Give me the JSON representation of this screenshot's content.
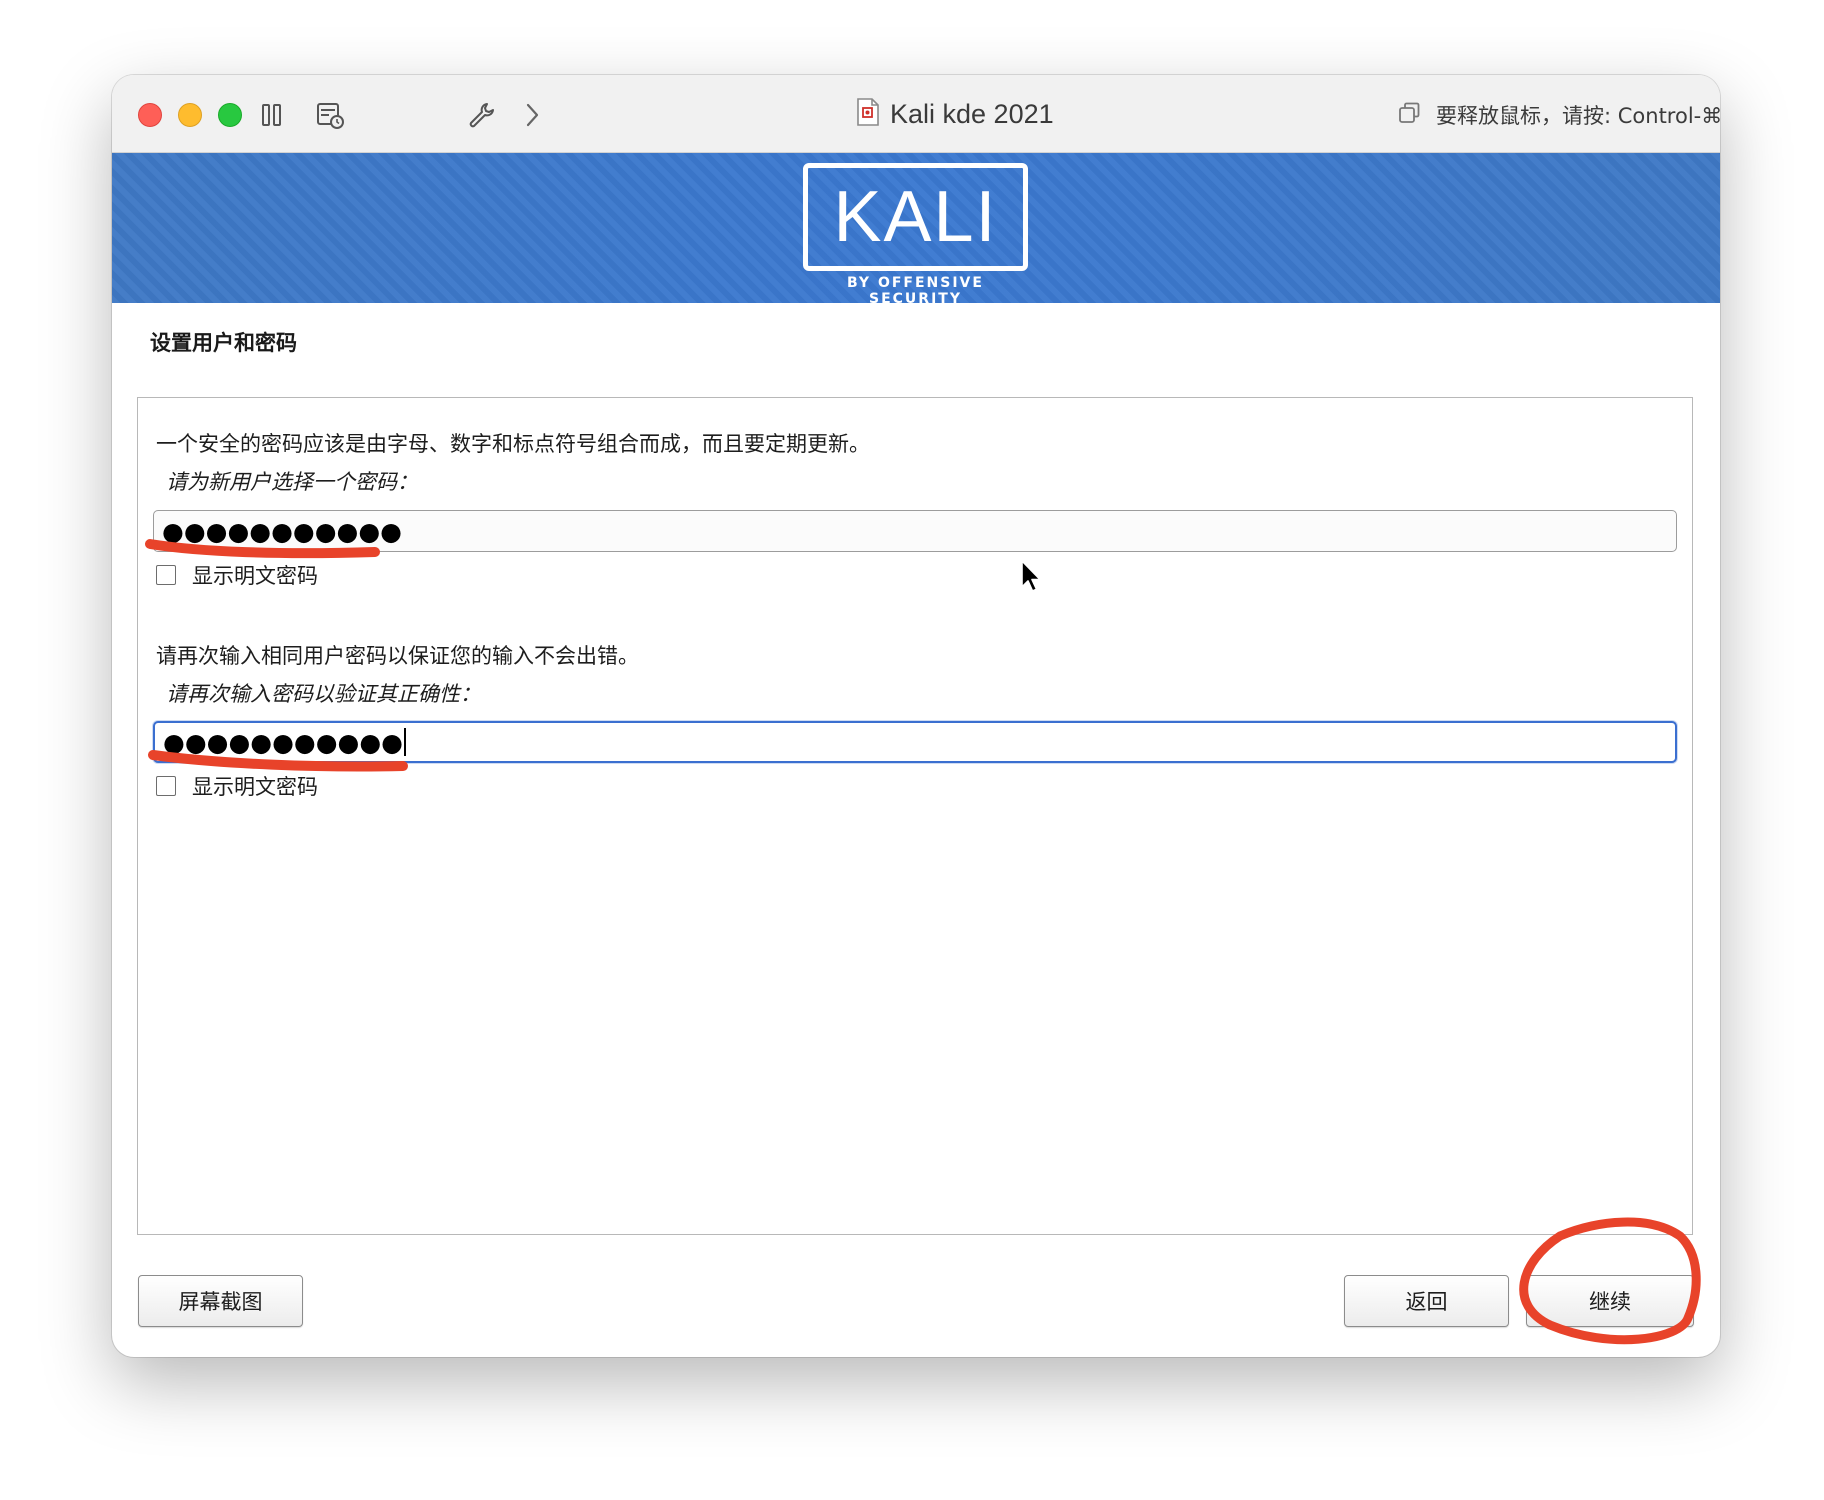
{
  "window": {
    "title": "Kali kde 2021",
    "release_hint": "要释放鼠标，请按: Control-⌘"
  },
  "banner": {
    "logo_text": "KALI",
    "logo_subtitle": "BY OFFENSIVE SECURITY"
  },
  "page": {
    "title": "设置用户和密码"
  },
  "form": {
    "intro": "一个安全的密码应该是由字母、数字和标点符号组合而成，而且要定期更新。",
    "password_prompt": "请为新用户选择一个密码：",
    "password_value": "●●●●●●●●●●●",
    "show_password_label_1": "显示明文密码",
    "confirm_intro": "请再次输入相同用户密码以保证您的输入不会出错。",
    "confirm_prompt": "请再次输入密码以验证其正确性：",
    "confirm_value": "●●●●●●●●●●●",
    "show_password_label_2": "显示明文密码"
  },
  "buttons": {
    "screenshot": "屏幕截图",
    "back": "返回",
    "continue": "继续"
  },
  "colors": {
    "banner": "#3b79d1",
    "annotation": "#e8432a",
    "focus_border": "#3b6fd0"
  }
}
